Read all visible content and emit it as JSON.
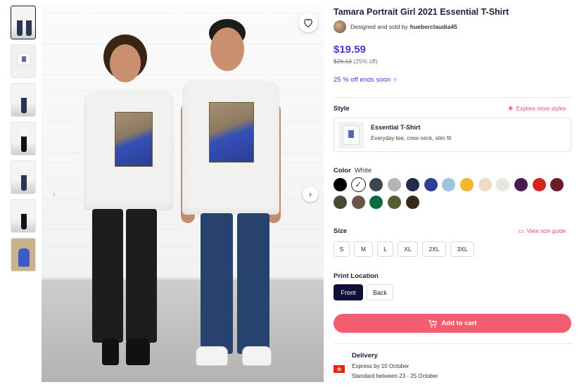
{
  "product": {
    "title": "Tamara Portrait Girl 2021 Essential T-Shirt",
    "designer_prefix": "Designed and sold by",
    "designer_name": "hueberclaudia45",
    "price": "$19.59",
    "old_price": "$26.13",
    "discount": "(25% off)",
    "promo": "25 % off ends soon"
  },
  "style": {
    "label": "Style",
    "explore_link": "Explore more styles",
    "selected_name": "Essential T-Shirt",
    "selected_desc": "Everyday tee, crew neck, slim fit"
  },
  "color": {
    "label": "Color",
    "selected": "White",
    "swatches": [
      "#000000",
      "#ffffff",
      "#3b4750",
      "#b5b5b5",
      "#262a4a",
      "#2f3f8f",
      "#9ec4e0",
      "#f2b632",
      "#ecdcc4",
      "#e6e6e2",
      "#4a1d4f",
      "#d82323",
      "#6b1a2b",
      "#4a4a33",
      "#6b5448",
      "#0b6b3c",
      "#585b2a",
      "#3a2a17"
    ]
  },
  "size": {
    "label": "Size",
    "guide_link": "View size guide",
    "options": [
      "S",
      "M",
      "L",
      "XL",
      "2XL",
      "3XL"
    ]
  },
  "print_location": {
    "label": "Print Location",
    "options": [
      "Front",
      "Back"
    ],
    "selected": "Front"
  },
  "cart": {
    "label": "Add to cart"
  },
  "delivery": {
    "title": "Delivery",
    "express": "Express by 10 October",
    "standard": "Standard between 23 - 25 October",
    "flag_glyph": "✿"
  },
  "icons": {
    "heart": "heart-icon",
    "prev": "‹",
    "next": "›",
    "check": "✓",
    "cart": "cart-icon",
    "sparkle": "✦",
    "layers": "❖",
    "ruler": "▭"
  }
}
